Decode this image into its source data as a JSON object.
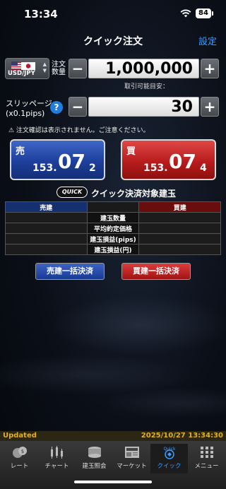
{
  "status": {
    "time": "13:34",
    "battery": "84"
  },
  "header": {
    "title": "クイック注文",
    "settings": "設定"
  },
  "order": {
    "pair": "USD/JPY",
    "quantity_label_1": "注文",
    "quantity_label_2": "数量",
    "quantity_value": "1,000,000",
    "available_label": "取引可能目安：",
    "slippage_label_1": "スリッページ",
    "slippage_label_2": "(x0.1pips)",
    "slippage_value": "30",
    "minus": "−",
    "plus": "+",
    "help": "?",
    "warning": "⚠ 注文確認は表示されません。ご注意ください。"
  },
  "prices": {
    "sell": {
      "side": "売",
      "int": "153.",
      "big": "07",
      "small": "2"
    },
    "buy": {
      "side": "買",
      "int": "153.",
      "big": "07",
      "small": "4"
    }
  },
  "quick_positions": {
    "logo": "QUICK",
    "title": "クイック決済対象建玉",
    "headers": {
      "sell": "売建",
      "mid": "",
      "buy": "買建"
    },
    "rows": [
      "建玉数量",
      "平均約定価格",
      "建玉損益(pips)",
      "建玉損益(円)"
    ],
    "settle_sell": "売建一括決済",
    "settle_buy": "買建一括決済"
  },
  "footer": {
    "updated": "Updated",
    "timestamp": "2025/10/27 13:34:30"
  },
  "tabs": [
    {
      "label": "レート",
      "icon": "rate-icon"
    },
    {
      "label": "チャート",
      "icon": "chart-icon"
    },
    {
      "label": "建玉照会",
      "icon": "position-icon"
    },
    {
      "label": "マーケット",
      "icon": "news-icon"
    },
    {
      "label": "クイック",
      "icon": "quick-icon"
    },
    {
      "label": "メニュー",
      "icon": "menu-icon"
    }
  ],
  "colors": {
    "accent": "#3a9cff",
    "sell": "#1d3f9c",
    "buy": "#b81c1c",
    "updated": "#e0b020"
  }
}
